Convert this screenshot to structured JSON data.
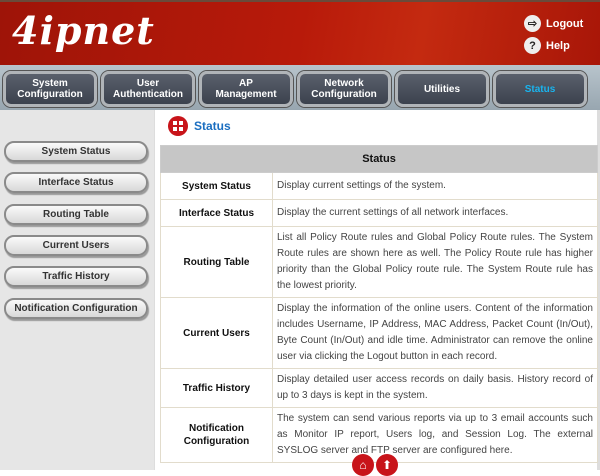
{
  "header": {
    "logo": "4ipnet",
    "logout": "Logout",
    "help": "Help"
  },
  "nav": [
    {
      "label": "System Configuration"
    },
    {
      "label": "User Authentication"
    },
    {
      "label": "AP Management"
    },
    {
      "label": "Network Configuration"
    },
    {
      "label": "Utilities"
    },
    {
      "label": "Status",
      "active": true
    }
  ],
  "sidebar": [
    "System Status",
    "Interface Status",
    "Routing Table",
    "Current Users",
    "Traffic History",
    "Notification Configuration"
  ],
  "page_title": "Status",
  "table": {
    "header": "Status",
    "rows": [
      {
        "name": "System Status",
        "desc": "Display current settings of the system."
      },
      {
        "name": "Interface Status",
        "desc": "Display the current settings of all network interfaces."
      },
      {
        "name": "Routing Table",
        "desc": "List all Policy Route rules and Global Policy Route rules. The System Route rules are shown here as well. The Policy Route rule has higher priority than the Global Policy route rule. The System Route rule has the lowest priority."
      },
      {
        "name": "Current Users",
        "desc": "Display the information of the online users. Content of the information includes Username, IP Address, MAC Address, Packet Count (In/Out), Byte Count (In/Out) and idle time. Administrator can remove the online user via clicking the Logout button in each record."
      },
      {
        "name": "Traffic History",
        "desc": "Display detailed user access records on daily basis. History record of up to 3 days is kept in the system."
      },
      {
        "name": "Notification Configuration",
        "desc": "The system can send various reports via up to 3 email accounts such as Monitor IP report, Users log, and Session Log. The external SYSLOG server and FTP server are configured here."
      }
    ]
  },
  "colors": {
    "brand": "#b81a0a",
    "accent": "#1a6ec0"
  }
}
